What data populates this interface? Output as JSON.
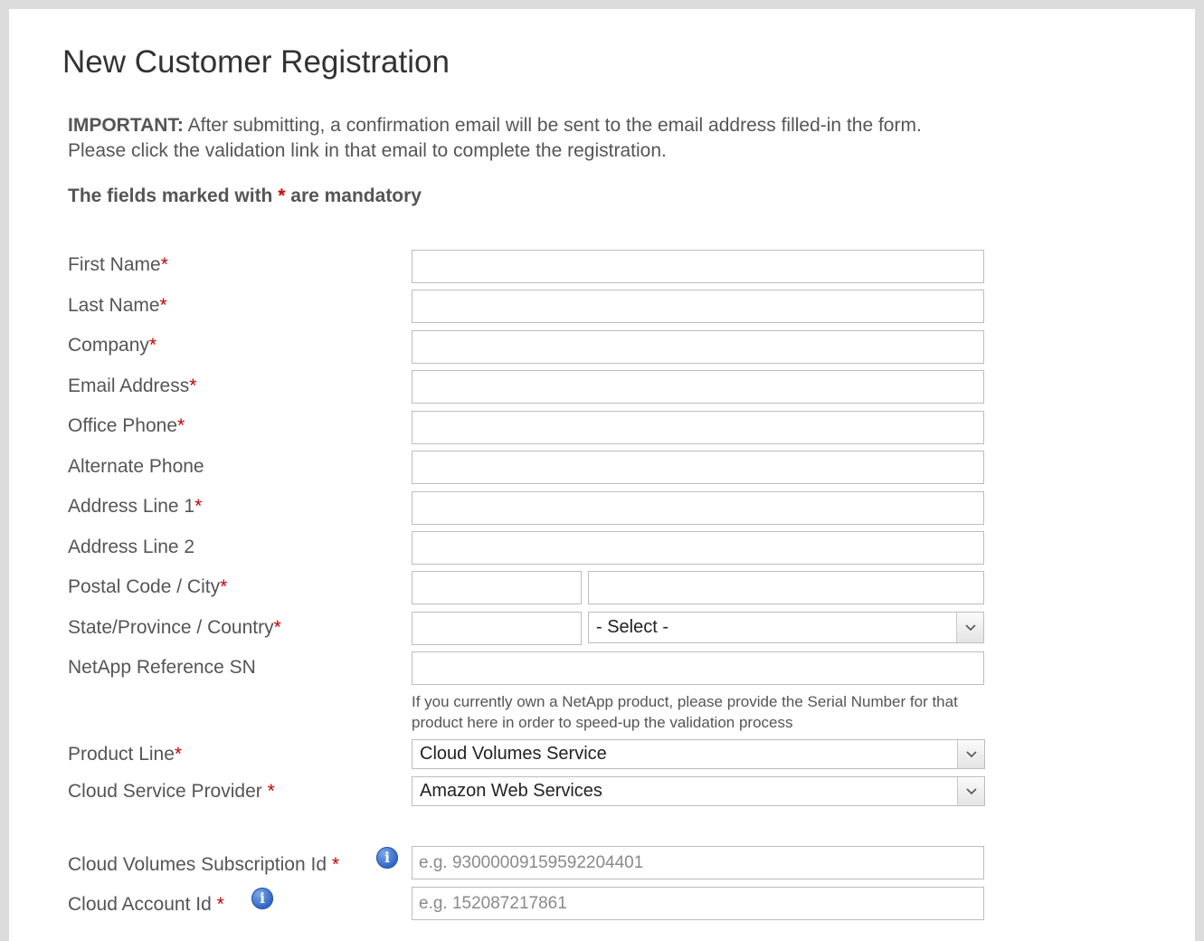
{
  "page": {
    "title": "New Customer Registration",
    "notice_bold": "IMPORTANT:",
    "notice_text": "After submitting, a confirmation email will be sent to the email address filled-in the form. Please click the validation link in that email to complete the registration.",
    "mandatory_prefix": "The fields marked with",
    "mandatory_star": "*",
    "mandatory_suffix": "are mandatory"
  },
  "fields": {
    "first_name": {
      "label": "First Name",
      "star": "*"
    },
    "last_name": {
      "label": "Last Name",
      "star": "*"
    },
    "company": {
      "label": "Company",
      "star": "*"
    },
    "email": {
      "label": "Email Address",
      "star": "*"
    },
    "office_phone": {
      "label": "Office Phone",
      "star": "*"
    },
    "alternate_phone": {
      "label": "Alternate Phone"
    },
    "address1": {
      "label": "Address Line 1",
      "star": "*"
    },
    "address2": {
      "label": "Address Line 2"
    },
    "postal_city": {
      "label": "Postal Code / City",
      "star": "*"
    },
    "state_country": {
      "label": "State/Province / Country",
      "star": "*",
      "country_selected": "- Select -"
    },
    "netapp_sn": {
      "label": "NetApp Reference SN",
      "help": "If you currently own a NetApp product, please provide the Serial Number for that product here in order to speed-up the validation process"
    },
    "product_line": {
      "label": "Product Line",
      "star": "*",
      "selected": "Cloud Volumes Service"
    },
    "cloud_provider": {
      "label": "Cloud Service Provider",
      "star": "*",
      "selected": "Amazon Web Services"
    },
    "subscription_id": {
      "label": "Cloud Volumes Subscription Id",
      "star": "*",
      "placeholder": "e.g. 93000009159592204401"
    },
    "account_id": {
      "label": "Cloud Account Id",
      "star": "*",
      "placeholder": "e.g. 152087217861"
    }
  },
  "icons": {
    "info": "info-icon",
    "dropdown": "chevron-down-icon"
  },
  "colors": {
    "required": "#cc0000",
    "info_icon": "#2f63c9"
  }
}
